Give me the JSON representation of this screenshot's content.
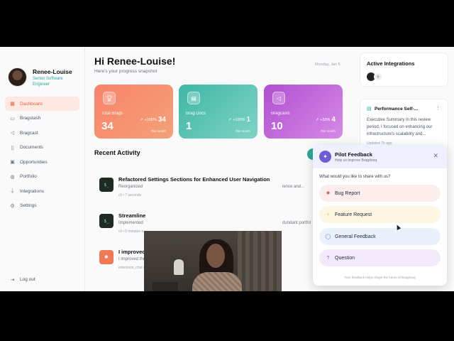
{
  "window": {
    "traffic_colors": [
      "#ff5f57",
      "#febc2e",
      "#28c840"
    ]
  },
  "profile": {
    "name": "Renee-Louise",
    "role": "Senior Software Engineer"
  },
  "nav": {
    "items": [
      {
        "label": "Dashboard",
        "icon": "grid-icon",
        "active": true
      },
      {
        "label": "Bragstash",
        "icon": "inbox-icon"
      },
      {
        "label": "Bragcast",
        "icon": "megaphone-icon"
      },
      {
        "label": "Documents",
        "icon": "document-icon"
      },
      {
        "label": "Opportunities",
        "icon": "briefcase-icon"
      },
      {
        "label": "Portfolio",
        "icon": "globe-icon"
      },
      {
        "label": "Integrations",
        "icon": "plug-icon"
      },
      {
        "label": "Settings",
        "icon": "gear-icon"
      }
    ],
    "logout": "Log out"
  },
  "header": {
    "greeting": "Hi Renee-Louise!",
    "subtitle": "Here's your progress snapshot",
    "date": "Monday, Jan 5"
  },
  "stats": [
    {
      "label": "Total Brags",
      "value": "34",
      "change": "+100%",
      "change_value": "34",
      "period": "this month",
      "color_from": "#f9836a",
      "color_to": "#f3a178"
    },
    {
      "label": "Brag Docs",
      "value": "1",
      "change": "+100%",
      "change_value": "1",
      "period": "this month",
      "color_from": "#3fb7a6",
      "color_to": "#7fd3c4"
    },
    {
      "label": "Bragcasts",
      "value": "10",
      "change": "+33%",
      "change_value": "4",
      "period": "this month",
      "color_from": "#b04fd0",
      "color_to": "#d68ae8"
    }
  ],
  "recent": {
    "title": "Recent Activity",
    "items": [
      {
        "title": "Refactored Settings Sections for Enhanced User Navigation",
        "desc": "Reorganized",
        "desc_tail": "ience and...",
        "meta": "cli • 7 seconds"
      },
      {
        "title": "Streamline",
        "desc": "Implemented",
        "desc_tail": "dundant portfol",
        "meta": "cli • 5 minutes a"
      },
      {
        "title": "I improved",
        "desc": "I improved the placeholder images to be more professional using canva",
        "desc_tail": "",
        "meta": "extension_chat • 2 hours ago"
      }
    ]
  },
  "integrations": {
    "title": "Active Integrations"
  },
  "review": {
    "title": "Performance Self-...",
    "text": "Executive Summary In this review period, I focused on enhancing our infrastructure's scalability and...",
    "updated": "Updated 7h ago"
  },
  "feedback": {
    "title": "Pilot Feedback",
    "subtitle": "Help us improve Bragdooq",
    "question": "What would you like to share with us?",
    "options": [
      {
        "label": "Bug Report",
        "icon": "bug-icon",
        "bg": "#fdeeee",
        "icon_color": "#e25555"
      },
      {
        "label": "Feature Request",
        "icon": "lightbulb-icon",
        "bg": "#fdf6e3",
        "icon_color": "#d9a320"
      },
      {
        "label": "General Feedback",
        "icon": "chat-icon",
        "bg": "#eaf1fd",
        "icon_color": "#3b7be0"
      },
      {
        "label": "Question",
        "icon": "question-icon",
        "bg": "#f3ebfc",
        "icon_color": "#8b4fd0"
      }
    ],
    "footer": "Your feedback helps shape the future of Bragdooq"
  }
}
